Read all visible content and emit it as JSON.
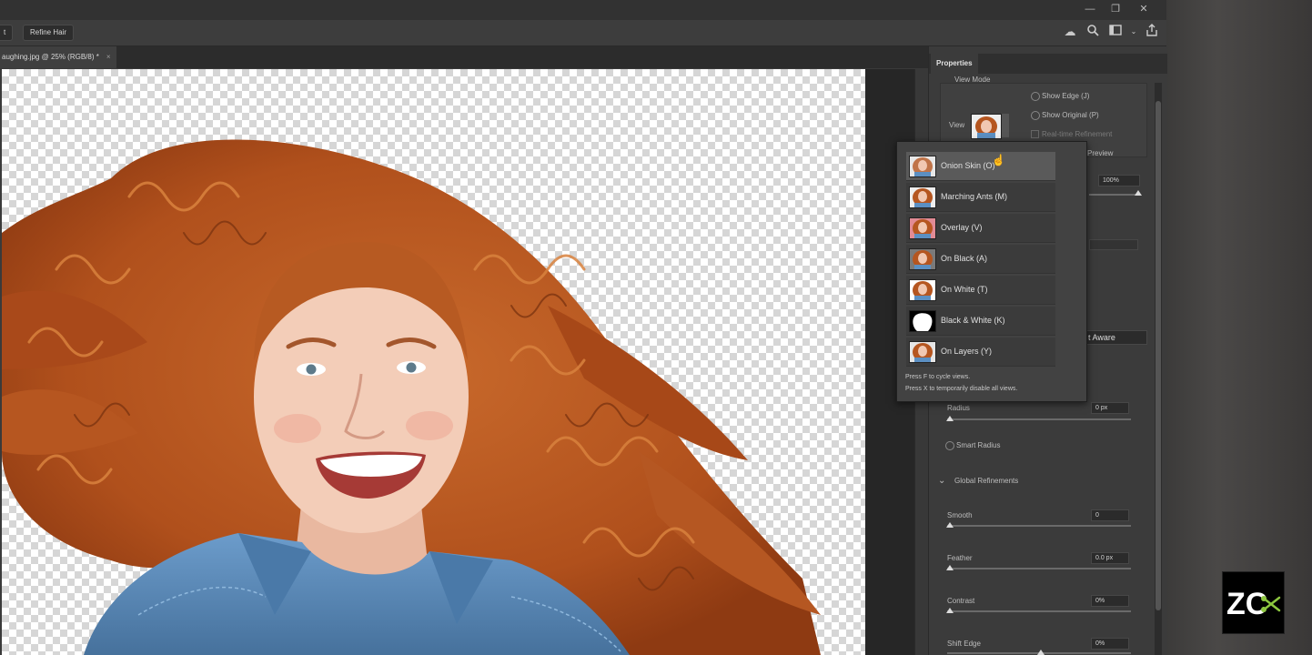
{
  "toolbar": {
    "tool_button_partial": "t",
    "refine_hair": "Refine Hair"
  },
  "document": {
    "tab_title": "aughing.jpg @ 25% (RGB/8) *",
    "tab_close": "×"
  },
  "properties": {
    "tab": "Properties",
    "view_mode_header": "View Mode",
    "view_label": "View",
    "show_edge": "Show Edge (J)",
    "show_original": "Show Original (P)",
    "real_time_refinement": "Real-time Refinement",
    "preview": "Preview",
    "opacity_value": "100%",
    "object_aware_partial": "t Aware",
    "radius_label": "Radius",
    "radius_value": "0 px",
    "smart_radius": "Smart Radius",
    "global_refinements": "Global Refinements",
    "smooth_label": "Smooth",
    "smooth_value": "0",
    "feather_label": "Feather",
    "feather_value": "0.0 px",
    "contrast_label": "Contrast",
    "contrast_value": "0%",
    "shift_edge_label": "Shift Edge",
    "shift_edge_value": "0%"
  },
  "view_menu": {
    "items": [
      {
        "label": "Onion Skin (O)",
        "selected": true,
        "thumb": "onion"
      },
      {
        "label": "Marching Ants (M)",
        "selected": false,
        "thumb": "normal"
      },
      {
        "label": "Overlay (V)",
        "selected": false,
        "thumb": "overlay"
      },
      {
        "label": "On Black (A)",
        "selected": false,
        "thumb": "black"
      },
      {
        "label": "On White (T)",
        "selected": false,
        "thumb": "white"
      },
      {
        "label": "Black & White (K)",
        "selected": false,
        "thumb": "bw"
      },
      {
        "label": "On Layers (Y)",
        "selected": false,
        "thumb": "layers"
      }
    ],
    "hint1": "Press F to cycle views.",
    "hint2": "Press X to temporarily disable all views."
  },
  "logo": {
    "text": "ZC"
  },
  "colors": {
    "hair": "#b8501c",
    "skin": "#f2c9b4",
    "denim": "#5b8fc2",
    "accent_logo": "#8cc63f"
  }
}
